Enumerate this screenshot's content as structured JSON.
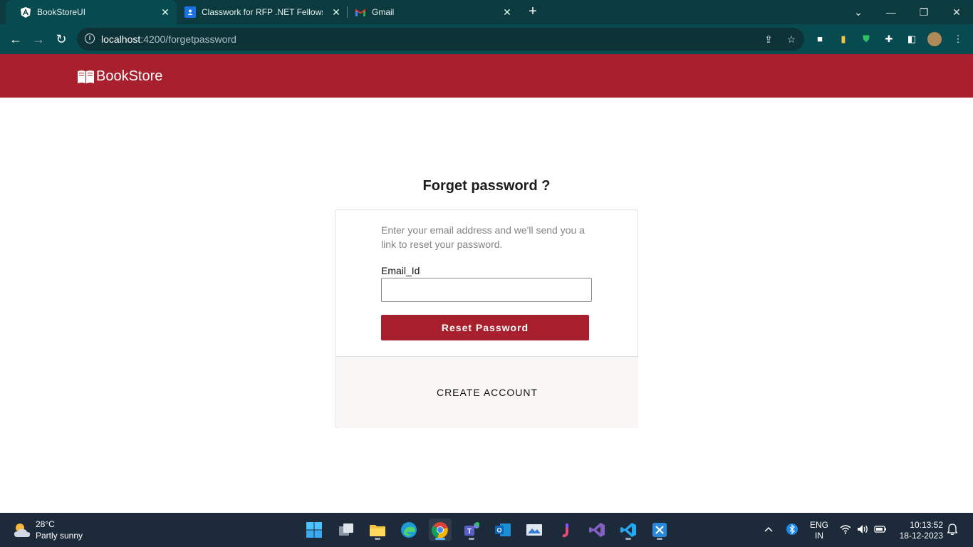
{
  "browser": {
    "tabs": [
      {
        "title": "BookStoreUI",
        "favicon": "angular-icon",
        "active": true
      },
      {
        "title": "Classwork for RFP .NET Fellowsh",
        "favicon": "classroom-icon",
        "active": false
      },
      {
        "title": "Gmail",
        "favicon": "gmail-icon",
        "active": false
      }
    ],
    "url_host": "localhost",
    "url_path": ":4200/forgetpassword"
  },
  "app": {
    "brand": "BookStore"
  },
  "form": {
    "title": "Forget password ?",
    "description": "Enter your email address and we'll send you a link to reset your password.",
    "email_label": "Email_Id",
    "email_value": "",
    "reset_label": "Reset Password",
    "create_account_label": "CREATE ACCOUNT"
  },
  "taskbar": {
    "weather_temp": "28°C",
    "weather_condition": "Partly sunny",
    "language_line1": "ENG",
    "language_line2": "IN",
    "time": "10:13:52",
    "date": "18-12-2023"
  },
  "colors": {
    "brand": "#a8202d",
    "toolbar": "#074b50",
    "tabstrip": "#0b3a3f",
    "taskbar": "#1c2a3a"
  }
}
